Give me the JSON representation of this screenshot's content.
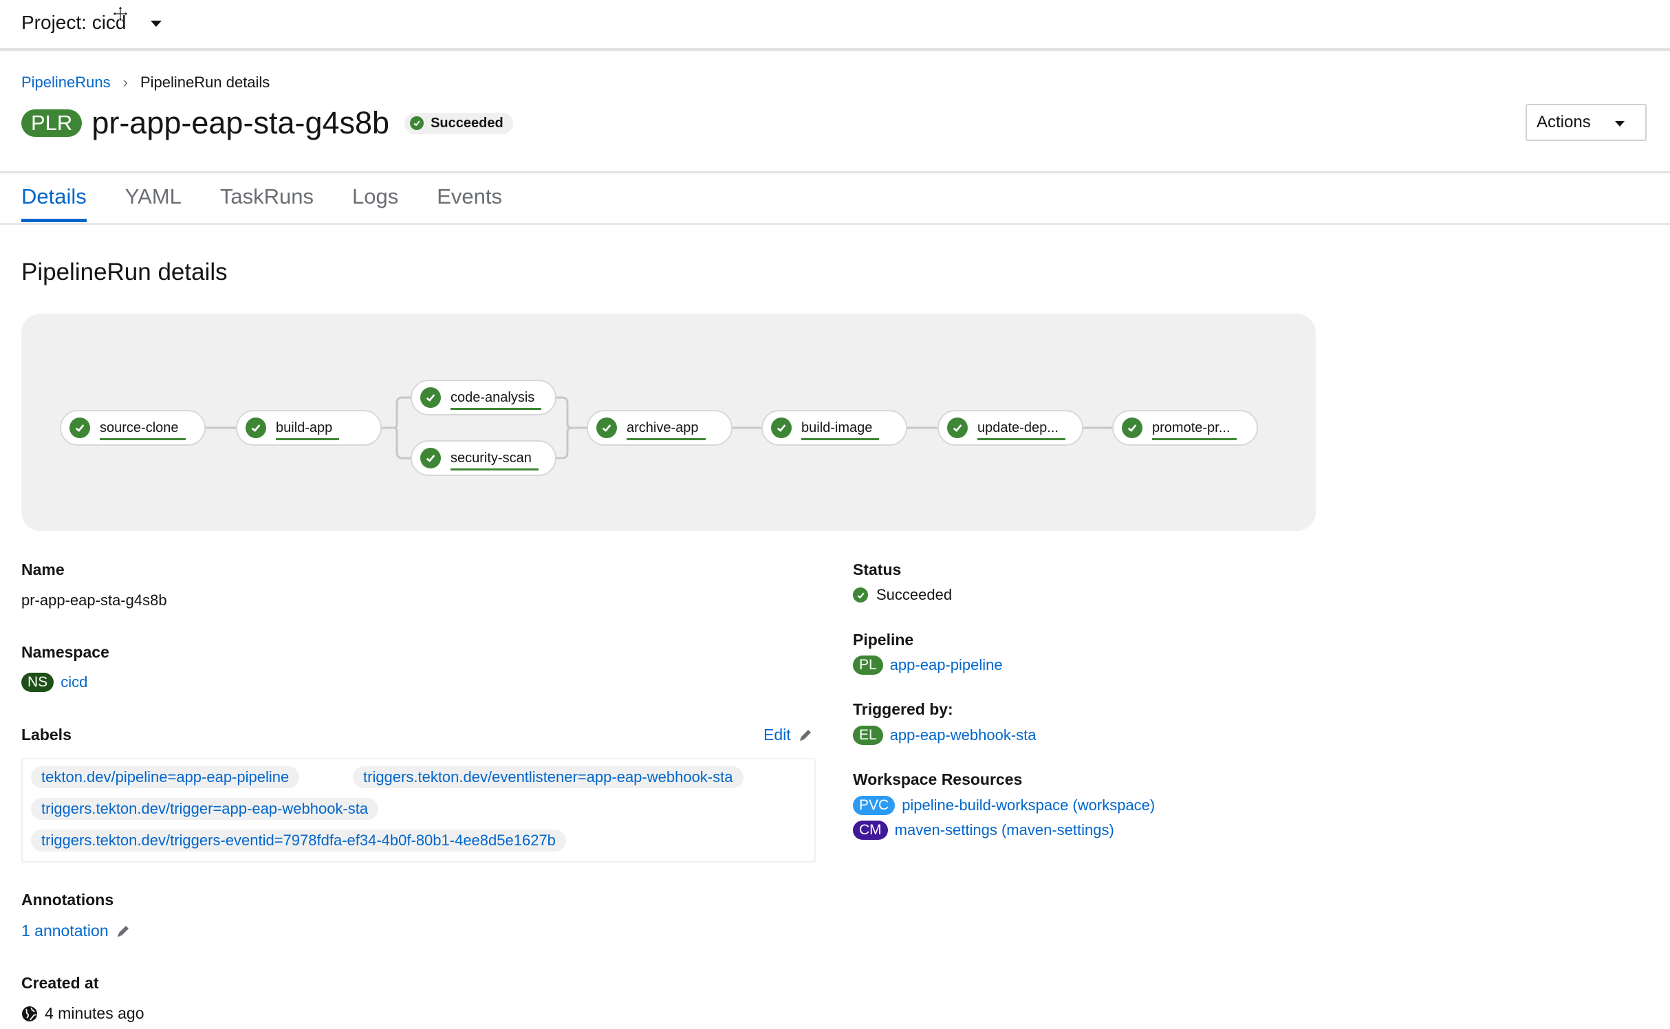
{
  "project_bar": {
    "label": "Project: cicd"
  },
  "breadcrumb": {
    "parent": "PipelineRuns",
    "current": "PipelineRun details"
  },
  "header": {
    "badge": "PLR",
    "title": "pr-app-eap-sta-g4s8b",
    "status": "Succeeded",
    "actions_label": "Actions"
  },
  "tabs": [
    "Details",
    "YAML",
    "TaskRuns",
    "Logs",
    "Events"
  ],
  "section_title": "PipelineRun details",
  "pipeline_graph": {
    "tasks": [
      "source-clone",
      "build-app",
      "code-analysis",
      "security-scan",
      "archive-app",
      "build-image",
      "update-dep...",
      "promote-pr..."
    ],
    "task_status": "succeeded"
  },
  "details_left": {
    "name_label": "Name",
    "name_value": "pr-app-eap-sta-g4s8b",
    "namespace_label": "Namespace",
    "namespace_badge": "NS",
    "namespace_value": "cicd",
    "labels_label": "Labels",
    "edit_label": "Edit",
    "labels": [
      "tekton.dev/pipeline=app-eap-pipeline",
      "triggers.tekton.dev/eventlistener=app-eap-webhook-sta",
      "triggers.tekton.dev/trigger=app-eap-webhook-sta",
      "triggers.tekton.dev/triggers-eventid=7978fdfa-ef34-4b0f-80b1-4ee8d5e1627b"
    ],
    "annotations_label": "Annotations",
    "annotations_value": "1 annotation",
    "created_label": "Created at",
    "created_value": "4 minutes ago"
  },
  "details_right": {
    "status_label": "Status",
    "status_value": "Succeeded",
    "pipeline_label": "Pipeline",
    "pipeline_badge": "PL",
    "pipeline_value": "app-eap-pipeline",
    "triggered_label": "Triggered by:",
    "triggered_badge": "EL",
    "triggered_value": "app-eap-webhook-sta",
    "workspace_label": "Workspace Resources",
    "workspaces": [
      {
        "badge": "PVC",
        "value": "pipeline-build-workspace (workspace)"
      },
      {
        "badge": "CM",
        "value": "maven-settings (maven-settings)"
      }
    ]
  },
  "colors": {
    "link": "#0066cc",
    "success": "#3e8635",
    "pvc_badge": "#2b9af3",
    "cm_badge": "#40199a"
  }
}
